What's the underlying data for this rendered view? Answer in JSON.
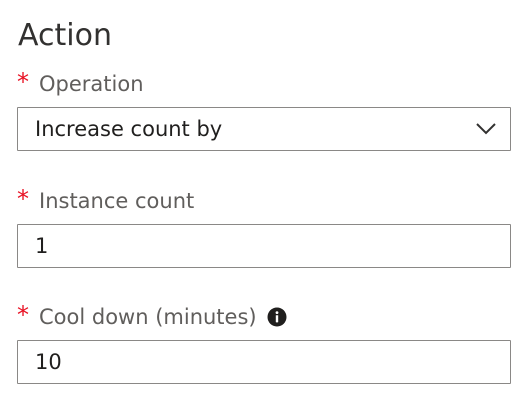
{
  "section": {
    "title": "Action"
  },
  "operation": {
    "required_mark": "*",
    "label": "Operation",
    "value": "Increase count by",
    "icon": "chevron-down-icon"
  },
  "instance_count": {
    "required_mark": "*",
    "label": "Instance count",
    "value": "1"
  },
  "cool_down": {
    "required_mark": "*",
    "label": "Cool down (minutes)",
    "value": "10",
    "icon": "info-icon"
  },
  "colors": {
    "required": "#e81123",
    "border": "#8a8886",
    "text": "#323130"
  }
}
